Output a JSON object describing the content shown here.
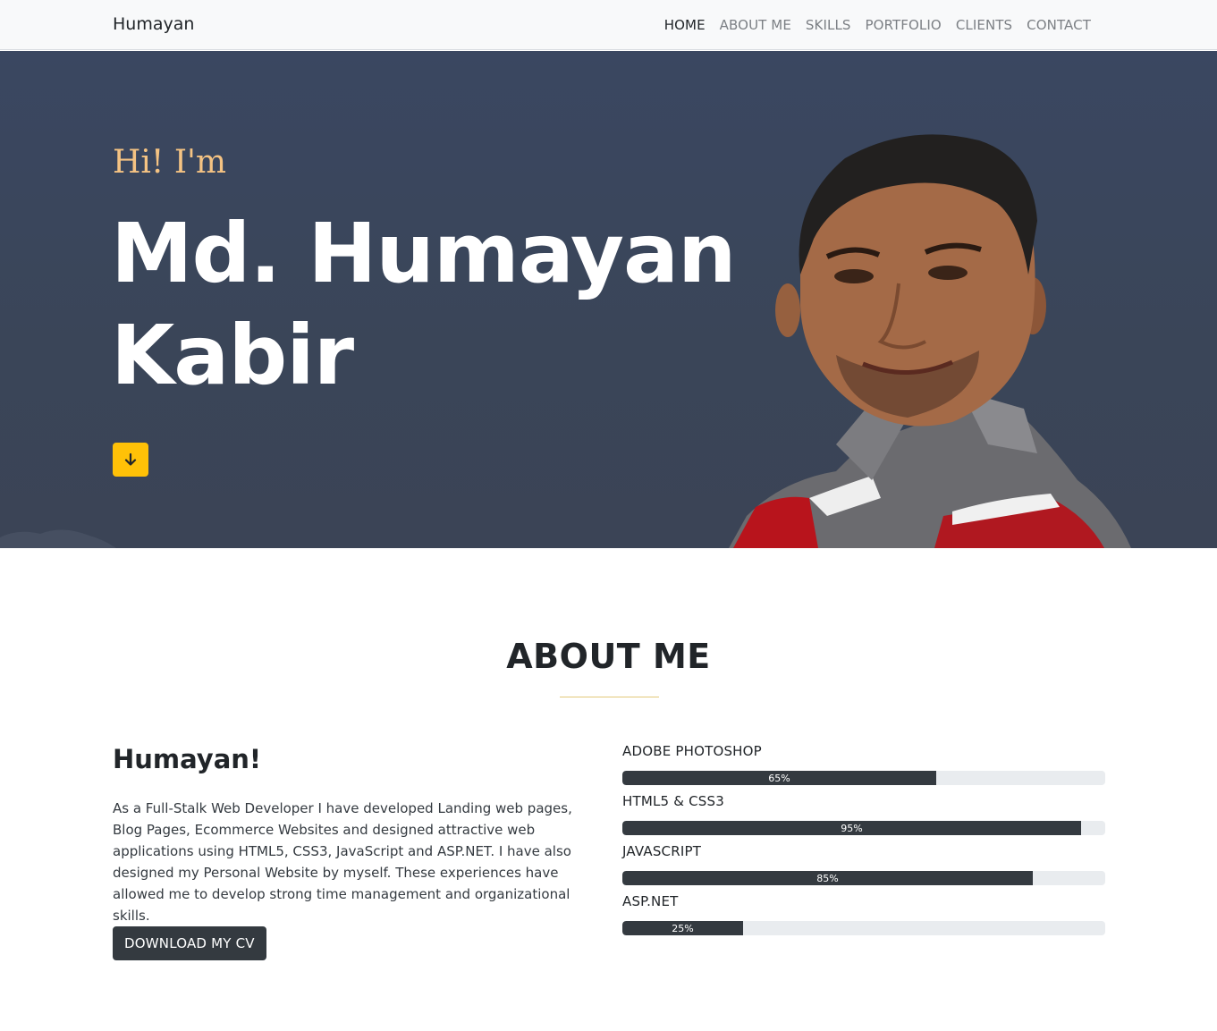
{
  "navbar": {
    "brand": "Humayan",
    "links": [
      {
        "label": "HOME",
        "active": true
      },
      {
        "label": "ABOUT ME",
        "active": false
      },
      {
        "label": "SKILLS",
        "active": false
      },
      {
        "label": "PORTFOLIO",
        "active": false
      },
      {
        "label": "CLIENTS",
        "active": false
      },
      {
        "label": "CONTACT",
        "active": false
      }
    ]
  },
  "hero": {
    "greeting": "Hi! I'm",
    "name_line1": "Md. Humayan",
    "name_line2": "Kabir",
    "scroll_icon": "arrow-down-icon",
    "accent_color": "#ffc107",
    "background_color": "#3a4558"
  },
  "about": {
    "section_title": "ABOUT ME",
    "heading": "Humayan!",
    "paragraph": "As a Full-Stalk Web Developer I have developed Landing web pages, Blog Pages, Ecommerce Websites and designed attractive web applications using HTML5, CSS3, JavaScript and ASP.NET. I have also designed my Personal Website by myself. These experiences have allowed me to develop strong time management and organizational skills.",
    "cv_button": "DOWNLOAD MY CV",
    "skills": [
      {
        "name": "ADOBE PHOTOSHOP",
        "percent": 65,
        "label": "65%"
      },
      {
        "name": "HTML5 & CSS3",
        "percent": 95,
        "label": "95%"
      },
      {
        "name": "JAVASCRIPT",
        "percent": 85,
        "label": "85%"
      },
      {
        "name": "ASP.NET",
        "percent": 25,
        "label": "25%"
      }
    ]
  }
}
